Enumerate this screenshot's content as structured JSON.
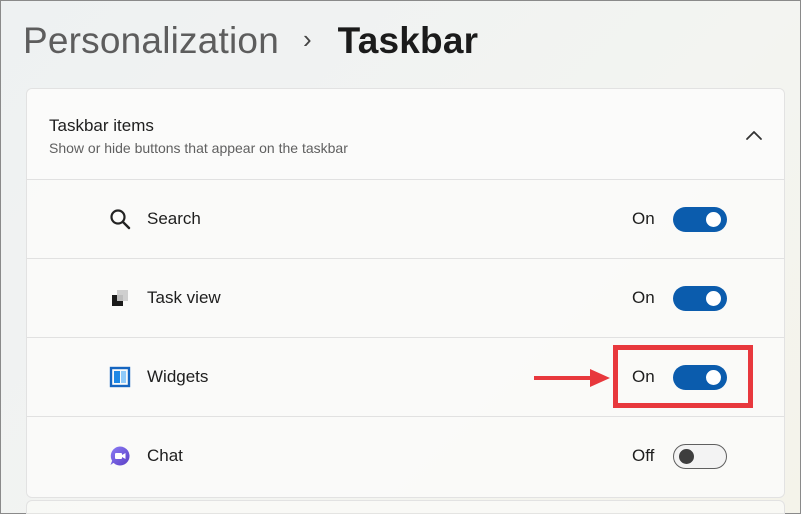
{
  "breadcrumb": {
    "parent": "Personalization",
    "separator": "›",
    "current": "Taskbar"
  },
  "group": {
    "title": "Taskbar items",
    "subtitle": "Show or hide buttons that appear on the taskbar",
    "collapse_icon": "chevron-up-icon"
  },
  "items": [
    {
      "label": "Search",
      "icon": "search-icon",
      "state": "On",
      "enabled": true
    },
    {
      "label": "Task view",
      "icon": "task-view-icon",
      "state": "On",
      "enabled": true
    },
    {
      "label": "Widgets",
      "icon": "widgets-icon",
      "state": "On",
      "enabled": true
    },
    {
      "label": "Chat",
      "icon": "chat-icon",
      "state": "Off",
      "enabled": false
    }
  ],
  "colors": {
    "accent": "#0b5cad",
    "callout": "#e8383d"
  }
}
